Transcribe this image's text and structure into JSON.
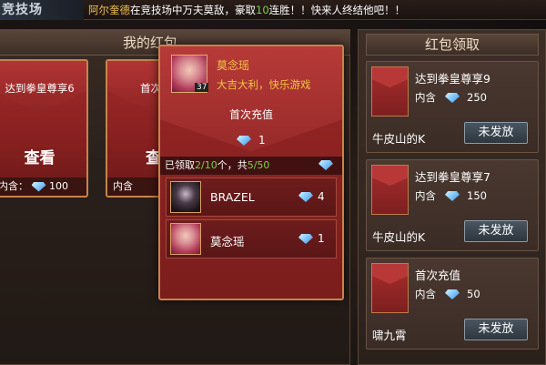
{
  "app_title": "竞技场",
  "marquee": {
    "name": "阿尔奎德",
    "text_before": "在竞技场中万夫莫敌，豪取",
    "streak": "10",
    "text_after": "连胜！！快来人终结他吧！！"
  },
  "left_panel": {
    "title": "我的红包",
    "packets": [
      {
        "title": "达到拳皇尊享6",
        "action": "查看",
        "contain_label": "内含：",
        "amount": "100",
        "icon": "diamond-icon"
      },
      {
        "title": "首次",
        "action": "查",
        "contain_label": "内含",
        "amount": "",
        "icon": "diamond-icon"
      }
    ]
  },
  "popup": {
    "sender_name": "莫念瑶",
    "sender_level": "37",
    "wish": "大吉大利，快乐游戏",
    "title": "首次充值",
    "amount": "1",
    "claimed_prefix": "已领取",
    "claimed_count": "2/10",
    "claimed_mid": "个，共",
    "claimed_total": "5/50",
    "records": [
      {
        "name": "BRAZEL",
        "amount": "4",
        "avatar": "dark-haired-avatar"
      },
      {
        "name": "莫念瑶",
        "amount": "1",
        "avatar": "pink-haired-avatar"
      }
    ]
  },
  "right_panel": {
    "title": "红包领取",
    "cards": [
      {
        "title": "达到拳皇尊享9",
        "contain_label": "内含",
        "amount": "250",
        "sender": "牛皮山的K",
        "button": "未发放"
      },
      {
        "title": "达到拳皇尊享7",
        "contain_label": "内含",
        "amount": "150",
        "sender": "牛皮山的K",
        "button": "未发放"
      },
      {
        "title": "首次充值",
        "contain_label": "内含",
        "amount": "50",
        "sender": "啸九霄",
        "button": "未发放"
      }
    ]
  },
  "colors": {
    "gold_text": "#f3c447",
    "green_text": "#79d34a",
    "packet_red": "#86201f",
    "border_gold": "#c8834a"
  }
}
